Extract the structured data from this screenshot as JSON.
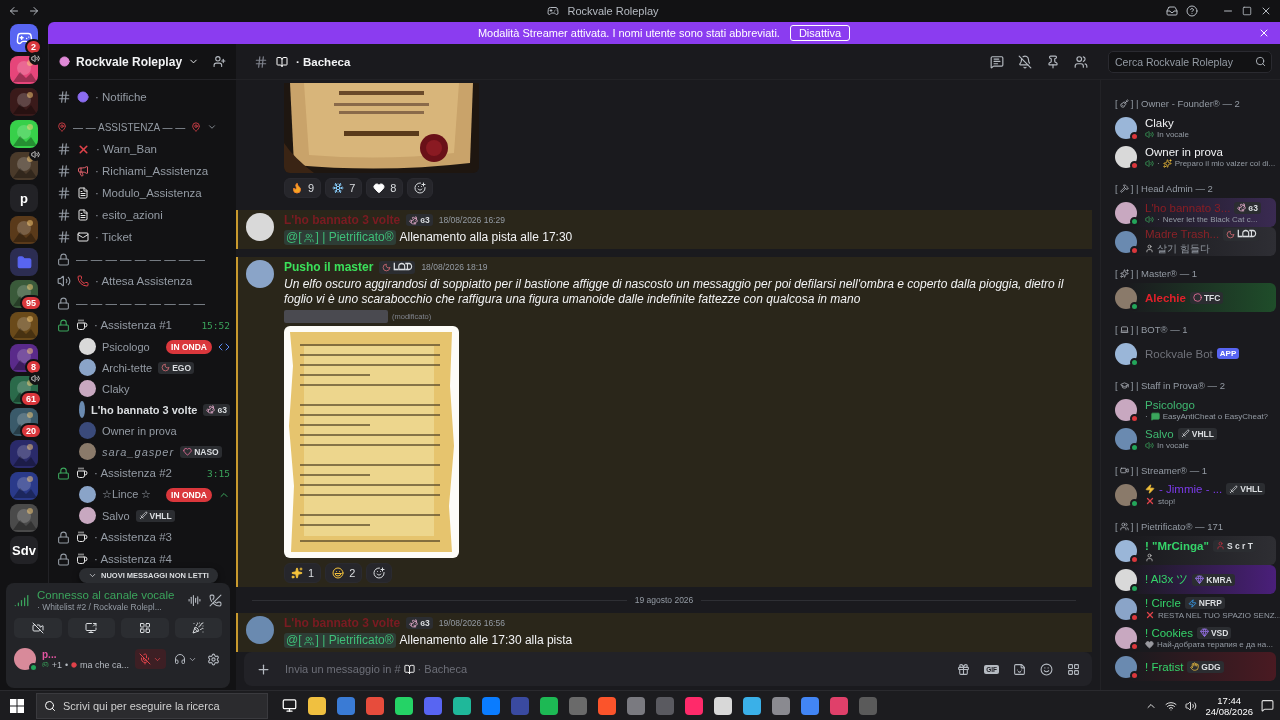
{
  "titlebar": {
    "title": "Rockvale Roleplay"
  },
  "banner": {
    "text": "Modalità Streamer attivata. I nomi utente sono stati abbreviati.",
    "button": "Disattiva"
  },
  "servers": [
    {
      "kind": "home",
      "badge": "2"
    },
    {
      "kind": "picture",
      "voice": true
    },
    {
      "kind": "picture"
    },
    {
      "kind": "picture"
    },
    {
      "kind": "picture",
      "voice": true
    },
    {
      "kind": "text",
      "label": "p"
    },
    {
      "kind": "picture"
    },
    {
      "kind": "folder"
    },
    {
      "kind": "picture",
      "badge": "95"
    },
    {
      "kind": "picture"
    },
    {
      "kind": "picture",
      "badge": "8"
    },
    {
      "kind": "picture",
      "voice": true,
      "badge": "61"
    },
    {
      "kind": "picture",
      "badge": "20"
    },
    {
      "kind": "picture"
    },
    {
      "kind": "picture"
    },
    {
      "kind": "picture"
    },
    {
      "kind": "text",
      "label": "Sdv"
    }
  ],
  "server_header": {
    "name": "Rockvale Roleplay"
  },
  "channels": [
    {
      "kind": "text",
      "name": "· Notifiche"
    },
    {
      "kind": "category",
      "name": "— — ASSISTENZA — —",
      "expanded": true
    },
    {
      "kind": "text",
      "name": "· Warn_Ban"
    },
    {
      "kind": "text",
      "name": "· Richiami_Assistenza"
    },
    {
      "kind": "text",
      "name": "· Modulo_Assistenza"
    },
    {
      "kind": "text",
      "name": "· esito_azioni"
    },
    {
      "kind": "text",
      "name": "· Ticket"
    },
    {
      "kind": "locked",
      "name": "— — — — — — — — —"
    },
    {
      "kind": "voice",
      "name": "· Attesa Assistenza"
    },
    {
      "kind": "locked",
      "name": "— — — — — — — — —"
    },
    {
      "kind": "voice_room",
      "active": true,
      "name": "· Assistenza #1",
      "timer": "15:52",
      "users": [
        {
          "name": "Psicologo",
          "live": "IN ONDA",
          "activity": true
        },
        {
          "name": "Archi-tette",
          "tag": "EGO"
        },
        {
          "name": "Claky"
        },
        {
          "name": "L'ho bannato 3 volte",
          "tag": "ɞ3",
          "bold": true
        },
        {
          "name": "Owner in prova"
        },
        {
          "name": "sara_gasper",
          "italic": true,
          "tag": "NASO"
        }
      ]
    },
    {
      "kind": "voice_room",
      "active": true,
      "name": "· Assistenza #2",
      "timer": "3:15",
      "users": [
        {
          "name": "☆Lince ☆",
          "live": "IN ONDA",
          "activity": true
        },
        {
          "name": "Salvo",
          "tag": "VHLL"
        }
      ]
    },
    {
      "kind": "voice_room",
      "active": false,
      "name": "· Assistenza #3"
    },
    {
      "kind": "voice_room",
      "active": false,
      "name": "· Assistenza #4"
    }
  ],
  "unread_pill": "NUOVI MESSAGGI NON LETTI",
  "voice_panel": {
    "status": "Connesso al canale vocale",
    "channel": "· Whitelist #2 / Rockvale Rolepl..."
  },
  "user_panel": {
    "name": "p...",
    "activity": "+1",
    "separator": "•",
    "custom_status": "ma che ca...",
    "mic_muted": true
  },
  "channel_header": {
    "name": "· Bacheca",
    "search_placeholder": "Cerca Rockvale Roleplay"
  },
  "messages": [
    {
      "highlighted": false,
      "reactions": [
        {
          "count": "9"
        },
        {
          "count": "7"
        },
        {
          "count": "8"
        }
      ]
    },
    {
      "kind": "message",
      "highlighted": true,
      "author": "L'ho bannato 3 volte",
      "color": "#7a1b22",
      "tag": "ɞ3",
      "time": "18/08/2026 16:29",
      "mention_open": "@[",
      "mention_close": "] | Pietrificato®",
      "text": "Allenamento alla pista alle 17:30"
    },
    {
      "kind": "message",
      "highlighted": true,
      "author": "Pusho il master",
      "color": "#3be05a",
      "tag": "ᒪᗝᗪ",
      "time": "18/08/2026 18:19",
      "italic": true,
      "text": "Un elfo oscuro aggirandosi di soppiatto per il bastione affigge di nascosto un messaggio per poi defilarsi nell'ombra e coperto dalla pioggia, dietro il foglio vi è uno scarabocchio che raffigura una figura umanoide dalle indefinite fattezze con qualcosa in mano",
      "edited": "(modificato)",
      "attachment": {
        "kind": "picture"
      },
      "reactions": [
        {
          "count": "1"
        },
        {
          "count": "2"
        }
      ]
    },
    {
      "kind": "divider",
      "text": "19 agosto 2026"
    },
    {
      "kind": "message",
      "highlighted": true,
      "author": "L'ho bannato 3 volte",
      "color": "#7a1b22",
      "tag": "ɞ3",
      "time": "19/08/2026 16:56",
      "mention_open": "@[",
      "mention_close": "] | Pietrificato®",
      "text": "Allenamento alle 17:30 alla pista"
    }
  ],
  "composer": {
    "prompt": "Invia un messaggio in #",
    "channel": "· Bacheca",
    "gif": "GIF"
  },
  "member_groups": [
    {
      "open": "[",
      "label": "] | Owner - Founder® — 2",
      "members": [
        {
          "name": "Claky",
          "color": "#f2f3f5",
          "dnd": true,
          "voice": true,
          "status": "In vocale"
        },
        {
          "name": "Owner in prova",
          "color": "#f2f3f5",
          "dnd": true,
          "voice": true,
          "lead": "·",
          "status": "Preparo il mio valzer col di..."
        }
      ]
    },
    {
      "open": "[",
      "label": "] | Head Admin — 2",
      "members": [
        {
          "name": "L'ho bannato 3...",
          "color": "#8a1d24",
          "dnd": false,
          "tag": "ɞ3",
          "nameplate": true,
          "voice": true,
          "lead": "·",
          "status": "Never let the Black Cat c..."
        },
        {
          "name": "Madre Trash...",
          "color": "#8a2228",
          "dnd": true,
          "tag": "ᒪᗝᗪ",
          "nameplate": true,
          "status": "살기 힘들다"
        }
      ]
    },
    {
      "open": "[",
      "label": "] | Master® — 1",
      "members": [
        {
          "name": "Alechie",
          "color": "#e0202a",
          "bold": true,
          "dnd": false,
          "tag": "TFC",
          "nameplate": true
        }
      ]
    },
    {
      "open": "[",
      "label": "] | BOT® — 1",
      "members": [
        {
          "name": "Rockvale Bot",
          "color": "#70727a",
          "dnd": false,
          "app": "APP"
        }
      ]
    },
    {
      "open": "[",
      "label": "] | Staff in Prova® — 2",
      "members": [
        {
          "name": "Psicologo",
          "color": "#3fb871",
          "dnd": true,
          "lead": "·",
          "status": "EasyAntiCheat o EasyCheat?"
        },
        {
          "name": "Salvo",
          "color": "#3fb871",
          "dnd": false,
          "tag": "VHLL",
          "voice": true,
          "status": "In vocale"
        }
      ]
    },
    {
      "open": "[",
      "label": "] | Streamer® — 1",
      "members": [
        {
          "name": "- Jimmie - ...",
          "color": "#7b3be8",
          "dnd": false,
          "tag": "VHLL",
          "status": "stop!"
        }
      ]
    },
    {
      "open": "[",
      "label": "] | Pietrificato® — 171",
      "members": [
        {
          "name": "! \"MrCinga\"",
          "color": "#35d46a",
          "bold": true,
          "dnd": true,
          "tag": "S c r T",
          "nameplate": true
        },
        {
          "name": "! Al3x ツ",
          "color": "#35d46a",
          "dnd": false,
          "tag": "KMRA",
          "nameplate": true
        },
        {
          "name": "! Circle",
          "color": "#35d46a",
          "dnd": true,
          "tag": "NFRP",
          "status": "RESTA NEL TUO SPAZIO SENZ..."
        },
        {
          "name": "! Cookies",
          "color": "#35d46a",
          "dnd": true,
          "tag": "VSD",
          "status": "Най-добрата терапия е да на..."
        },
        {
          "name": "! Fratist",
          "color": "#35d46a",
          "dnd": true,
          "tag": "GDG",
          "nameplate": true
        }
      ]
    }
  ],
  "taskbar": {
    "search_placeholder": "Scrivi qui per eseguire la ricerca",
    "time": "17:44",
    "date": "24/08/2026"
  }
}
